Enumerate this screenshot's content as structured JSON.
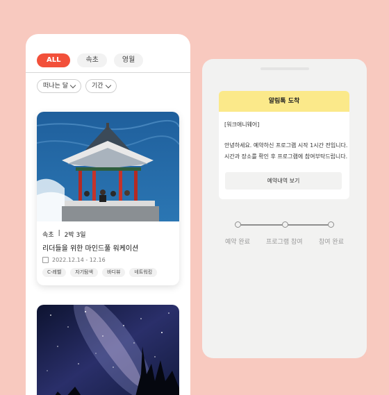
{
  "colors": {
    "background": "#f8c9bf",
    "accent": "#f2503a",
    "alert_header": "#fbe98a"
  },
  "left_phone": {
    "chips": [
      {
        "label": "ALL",
        "active": true
      },
      {
        "label": "속초",
        "active": false
      },
      {
        "label": "영월",
        "active": false
      }
    ],
    "filters": [
      {
        "label": "떠나는 달"
      },
      {
        "label": "기간"
      }
    ],
    "card": {
      "image": "seaside-pavilion-photo",
      "location": "속초",
      "separator": "|",
      "duration": "2박 3일",
      "title": "리더들을 위한 마인드풀 워케이션",
      "date_range": "2022.12.14 - 12.16",
      "tags": [
        "C-레벨",
        "자기탐색",
        "바디뷰",
        "네트워킹"
      ]
    },
    "card2": {
      "image": "starry-night-photo"
    }
  },
  "right_phone": {
    "alert": {
      "header": "알림톡 도착",
      "sender": "[워크애니웨어]",
      "message_line1": "안녕하세요. 예약하신 프로그램 시작 1시간 전입니다.",
      "message_line2": "시간과 장소를 확인 후 프로그램에 참여부탁드립니다.",
      "button_label": "예약내역 보기"
    },
    "steps": [
      {
        "label": "예약 완료"
      },
      {
        "label": "프로그램 참여"
      },
      {
        "label": "참여 완료"
      }
    ]
  }
}
